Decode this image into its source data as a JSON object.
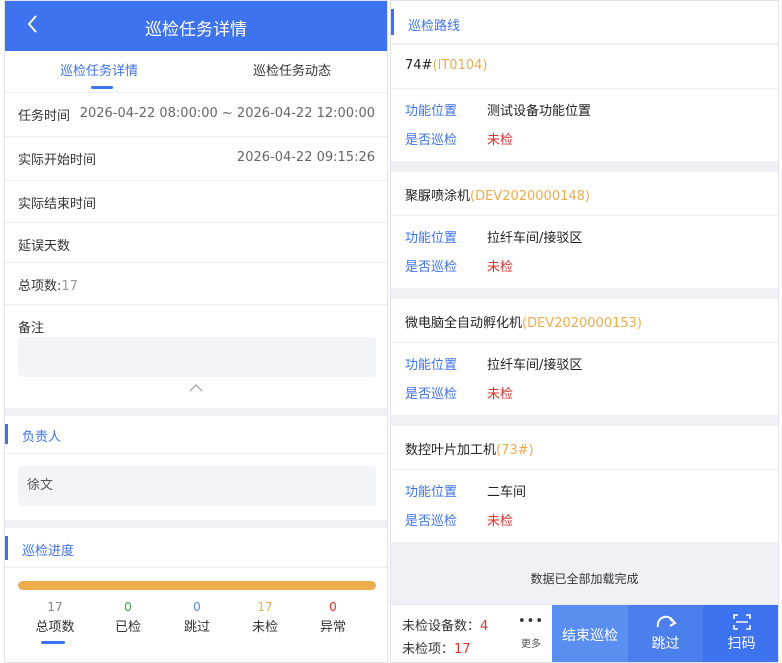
{
  "detail": {
    "title": "巡检任务详情",
    "tabs": [
      "巡检任务详情",
      "巡检任务动态"
    ],
    "fields": {
      "task_time_label": "任务时间",
      "task_time_value": "2026-04-22 08:00:00 ~ 2026-04-22 12:00:00",
      "actual_start_label": "实际开始时间",
      "actual_start_value": "2026-04-22 09:15:26",
      "actual_end_label": "实际结束时间",
      "actual_end_value": "",
      "delay_label": "延误天数",
      "delay_value": "",
      "total_label": "总项数:",
      "total_value": "17",
      "remark_label": "备注",
      "remark_value": ""
    },
    "owner": {
      "section_title": "负责人",
      "name": "徐文"
    },
    "progress": {
      "section_title": "巡检进度",
      "fraction": 1.0,
      "bar_color": "#f0ad4e",
      "stats": [
        {
          "value": "17",
          "label": "总项数",
          "color": "#888888"
        },
        {
          "value": "0",
          "label": "已检",
          "color": "#3aa84a"
        },
        {
          "value": "0",
          "label": "跳过",
          "color": "#4a90e2"
        },
        {
          "value": "17",
          "label": "未检",
          "color": "#f0ad4e"
        },
        {
          "value": "0",
          "label": "异常",
          "color": "#e0302f"
        }
      ]
    }
  },
  "route": {
    "section_title": "巡检路线",
    "location_label": "功能位置",
    "inspected_label": "是否巡检",
    "items": [
      {
        "name": "74#",
        "code": "(IT0104)",
        "location": "测试设备功能位置",
        "inspected": "未检"
      },
      {
        "name": "聚脲喷涂机",
        "code": "(DEV2020000148)",
        "location": "拉纤车间/接驳区",
        "inspected": "未检"
      },
      {
        "name": "微电脑全自动孵化机",
        "code": "(DEV2020000153)",
        "location": "拉纤车间/接驳区",
        "inspected": "未检"
      },
      {
        "name": "数控叶片加工机",
        "code": "(73#)",
        "location": "二车间",
        "inspected": "未检"
      }
    ],
    "loaded_text": "数据已全部加载完成"
  },
  "bottom_bar": {
    "uninspected_devices_label": "未检设备数：",
    "uninspected_devices_value": "4",
    "uninspected_items_label": "未检项：",
    "uninspected_items_value": "17",
    "more_label": "更多",
    "end_button": "结束巡检",
    "skip_button": "跳过",
    "scan_button": "扫码"
  },
  "colors": {
    "primary": "#3d73ee",
    "accent_orange": "#f0ad4e",
    "danger_red": "#e0302f"
  }
}
